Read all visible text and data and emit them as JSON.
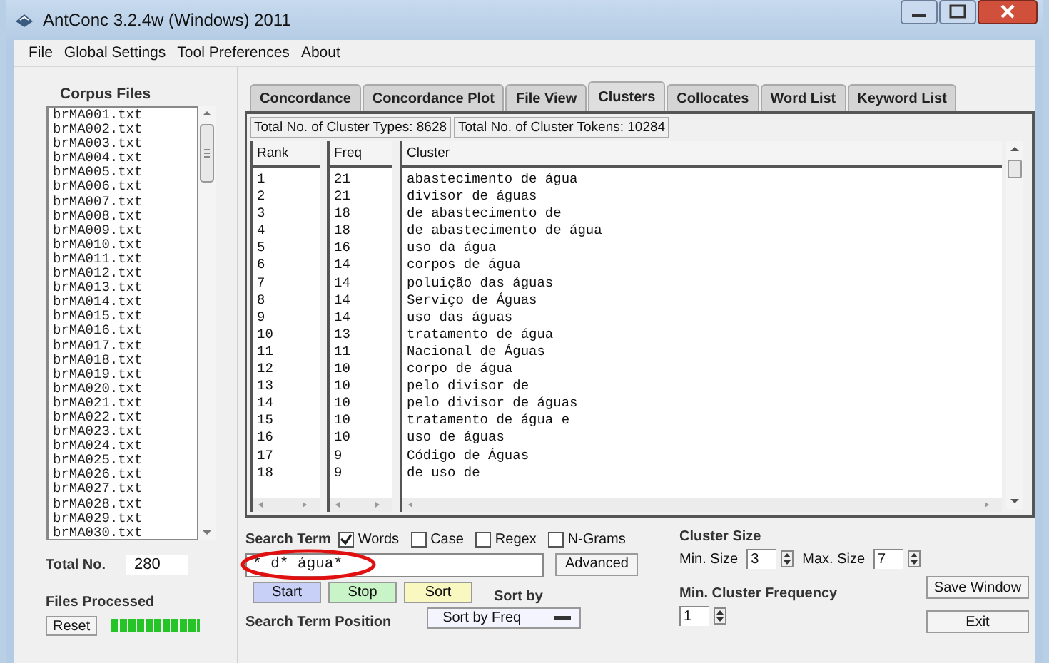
{
  "window": {
    "title": "AntConc 3.2.4w (Windows) 2011"
  },
  "menu": [
    "File",
    "Global Settings",
    "Tool Preferences",
    "About"
  ],
  "corpus_files": {
    "title": "Corpus Files",
    "files": [
      "brMA001.txt",
      "brMA002.txt",
      "brMA003.txt",
      "brMA004.txt",
      "brMA005.txt",
      "brMA006.txt",
      "brMA007.txt",
      "brMA008.txt",
      "brMA009.txt",
      "brMA010.txt",
      "brMA011.txt",
      "brMA012.txt",
      "brMA013.txt",
      "brMA014.txt",
      "brMA015.txt",
      "brMA016.txt",
      "brMA017.txt",
      "brMA018.txt",
      "brMA019.txt",
      "brMA020.txt",
      "brMA021.txt",
      "brMA022.txt",
      "brMA023.txt",
      "brMA024.txt",
      "brMA025.txt",
      "brMA026.txt",
      "brMA027.txt",
      "brMA028.txt",
      "brMA029.txt",
      "brMA030.txt"
    ]
  },
  "total_no": {
    "label": "Total No.",
    "value": "280"
  },
  "files_processed": {
    "label": "Files Processed",
    "reset": "Reset"
  },
  "tabs": [
    {
      "label": "Concordance",
      "selected": false
    },
    {
      "label": "Concordance Plot",
      "selected": false
    },
    {
      "label": "File View",
      "selected": false
    },
    {
      "label": "Clusters",
      "selected": true
    },
    {
      "label": "Collocates",
      "selected": false
    },
    {
      "label": "Word List",
      "selected": false
    },
    {
      "label": "Keyword List",
      "selected": false
    }
  ],
  "totals": [
    "Total No. of Cluster Types: 8628",
    "Total No. of Cluster Tokens: 10284"
  ],
  "table": {
    "columns": [
      "Rank",
      "Freq",
      "Cluster"
    ],
    "rows": [
      [
        "1",
        "21",
        "abastecimento de água"
      ],
      [
        "2",
        "21",
        "divisor de águas"
      ],
      [
        "3",
        "18",
        "de abastecimento de"
      ],
      [
        "4",
        "18",
        "de abastecimento de água"
      ],
      [
        "5",
        "16",
        "uso da água"
      ],
      [
        "6",
        "14",
        "corpos de água"
      ],
      [
        "7",
        "14",
        "poluição das águas"
      ],
      [
        "8",
        "14",
        "Serviço de Águas"
      ],
      [
        "9",
        "14",
        "uso das águas"
      ],
      [
        "10",
        "13",
        "tratamento de água"
      ],
      [
        "11",
        "11",
        "Nacional de Águas"
      ],
      [
        "12",
        "10",
        "corpo de água"
      ],
      [
        "13",
        "10",
        "pelo divisor de"
      ],
      [
        "14",
        "10",
        "pelo divisor de águas"
      ],
      [
        "15",
        "10",
        "tratamento de água e"
      ],
      [
        "16",
        "10",
        "uso de águas"
      ],
      [
        "17",
        "9",
        "Código de Águas"
      ],
      [
        "18",
        "9",
        "de uso de"
      ]
    ]
  },
  "search": {
    "label": "Search Term",
    "options": [
      {
        "label": "Words",
        "checked": true
      },
      {
        "label": "Case",
        "checked": false
      },
      {
        "label": "Regex",
        "checked": false
      },
      {
        "label": "N-Grams",
        "checked": false
      }
    ],
    "value": "* d* água*",
    "circled": true,
    "advanced": "Advanced"
  },
  "actions": [
    {
      "label": "Start",
      "color": "#c8d0f8"
    },
    {
      "label": "Stop",
      "color": "#c8f4c8"
    },
    {
      "label": "Sort",
      "color": "#f8f8c0"
    }
  ],
  "search_term_position": {
    "label": "Search Term Position"
  },
  "sort_by": {
    "label": "Sort by",
    "value": "Sort by Freq"
  },
  "cluster_size": {
    "label": "Cluster Size",
    "min_label": "Min. Size",
    "min": "3",
    "max_label": "Max. Size",
    "max": "7"
  },
  "min_cluster_frequency": {
    "label": "Min. Cluster Frequency",
    "value": "1"
  },
  "buttons": [
    "Save Window",
    "Exit"
  ]
}
